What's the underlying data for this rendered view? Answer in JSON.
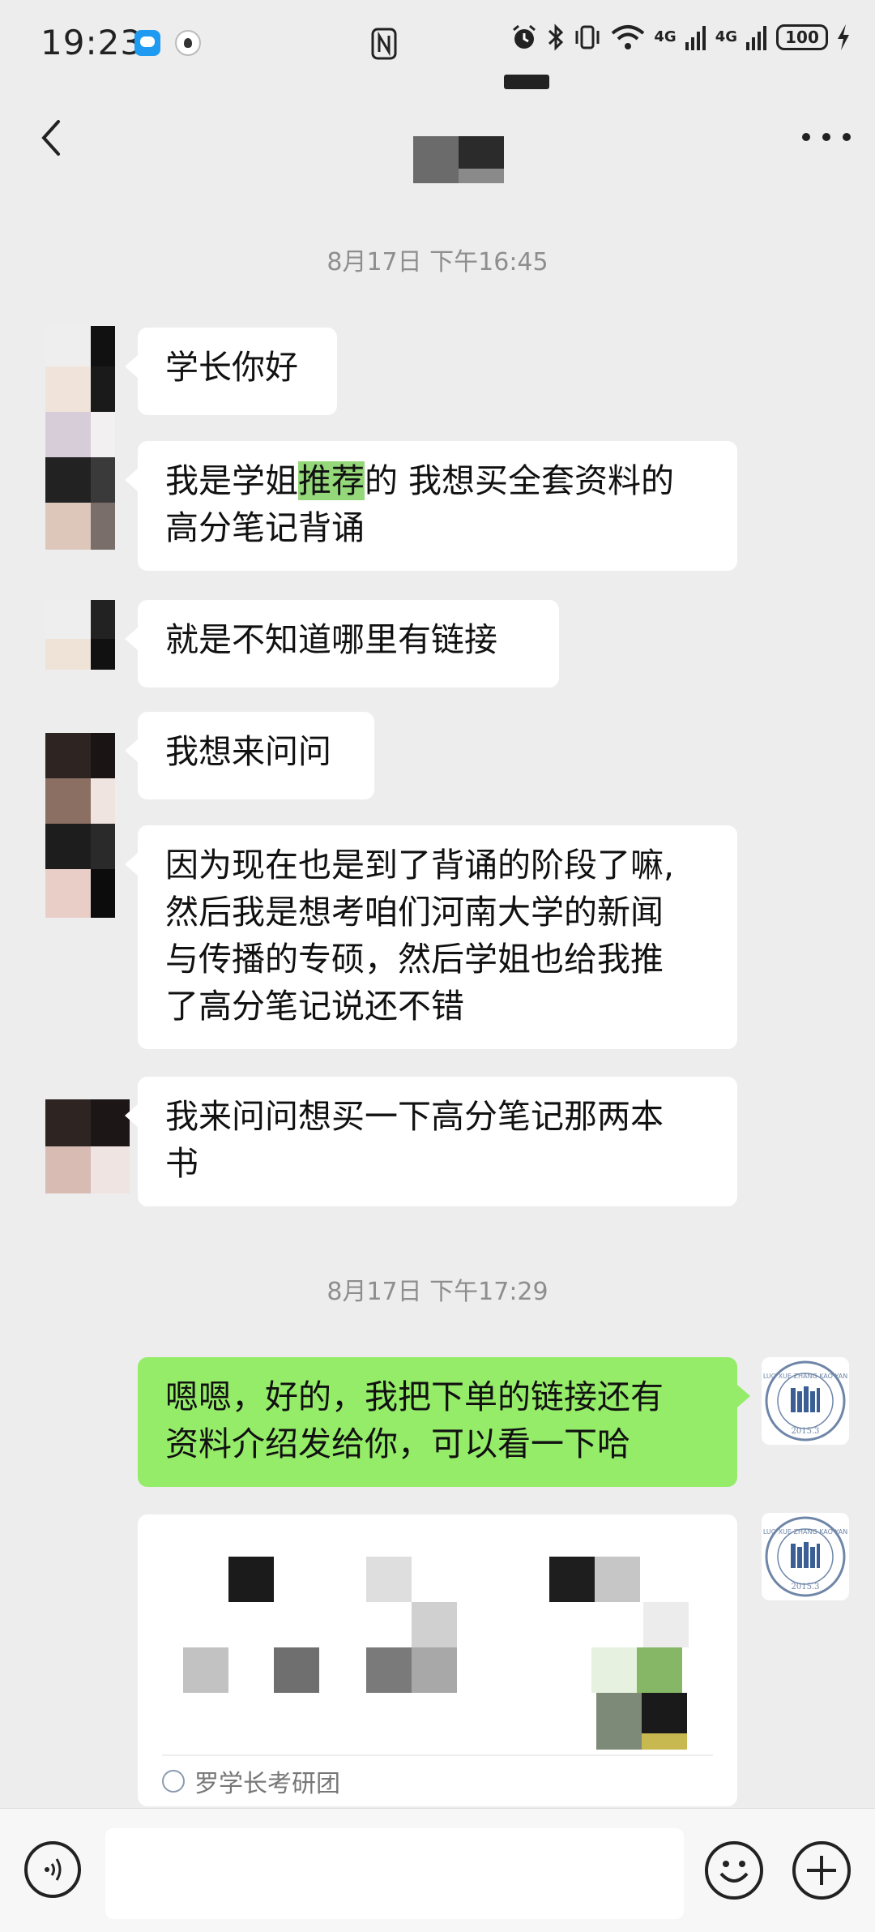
{
  "status_bar": {
    "time": "19:23",
    "network_1": "4G",
    "network_2": "4G",
    "battery": "100"
  },
  "nav": {
    "back_icon": "chevron-left-icon",
    "more_icon": "more-dots-icon"
  },
  "messages": {
    "ts1": "8月17日 下午16:45",
    "m1": "学长你好",
    "m2_a": "我是学姐",
    "m2_hl": "推荐",
    "m2_b": "的 我想买全套资料的\n高分笔记背诵",
    "m3": "就是不知道哪里有链接",
    "m4": "我想来问问",
    "m5": "因为现在也是到了背诵的阶段了嘛,\n然后我是想考咱们河南大学的新闻\n与传播的专硕，然后学姐也给我推\n了高分笔记说还不错",
    "m6": "我来问问想买一下高分笔记那两本\n书",
    "ts2": "8月17日 下午17:29",
    "r1": "嗯嗯，好的，我把下单的链接还有\n资料介绍发给你，可以看一下哈",
    "card_source": "罗学长考研团"
  },
  "logo": {
    "arc_text": "LUO XUE ZHANG KAO YAN",
    "year": "2015.3"
  },
  "colors": {
    "background": "#EDEDED",
    "bubble_left": "#FFFFFF",
    "bubble_right": "#95EC69"
  }
}
